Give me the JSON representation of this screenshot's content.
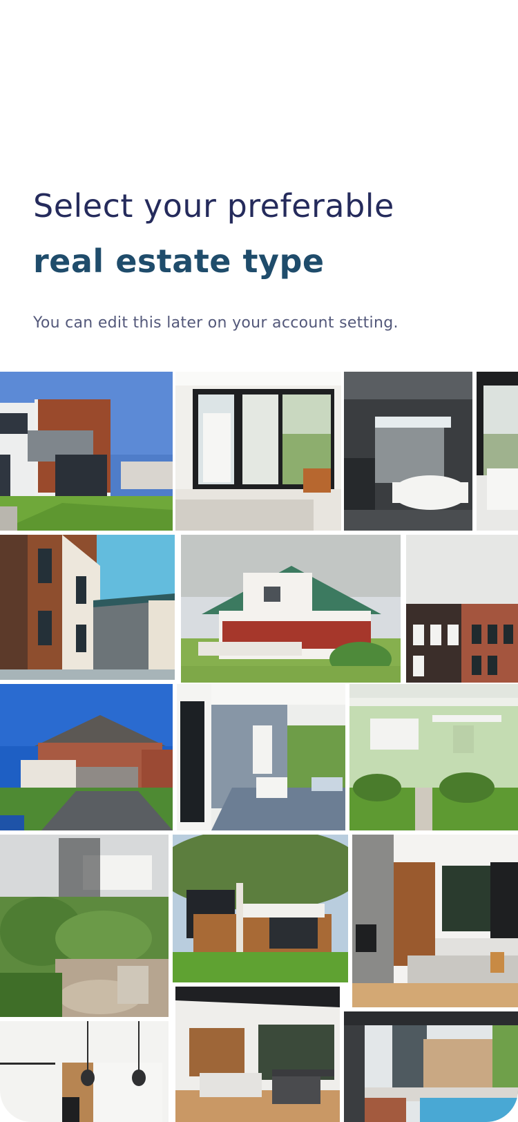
{
  "header": {
    "title_line1": "Select your preferable",
    "title_line2": "real estate type",
    "subtitle": "You can edit this later on your account setting."
  },
  "gallery": {
    "tiles": [
      {
        "icon": "modern-house-photo"
      },
      {
        "icon": "bedroom-balcony-photo"
      },
      {
        "icon": "bathroom-photo"
      },
      {
        "icon": "interior-photo"
      },
      {
        "icon": "townhouse-facade-photo"
      },
      {
        "icon": "craftsman-house-photo"
      },
      {
        "icon": "brick-rowhouses-photo"
      },
      {
        "icon": "brick-suburban-house-photo"
      },
      {
        "icon": "porch-photo"
      },
      {
        "icon": "green-bungalow-photo"
      },
      {
        "icon": "cottage-garden-photo"
      },
      {
        "icon": "backyard-modern-house-photo"
      },
      {
        "icon": "living-room-fireplace-photo"
      },
      {
        "icon": "kitchen-pendants-photo"
      },
      {
        "icon": "open-living-dining-photo"
      },
      {
        "icon": "pool-courtyard-photo"
      }
    ]
  },
  "colors": {
    "title": "#252B5C",
    "title_bold": "#1F4C6B",
    "subtitle": "#53587A",
    "background": "#FFFFFF"
  }
}
